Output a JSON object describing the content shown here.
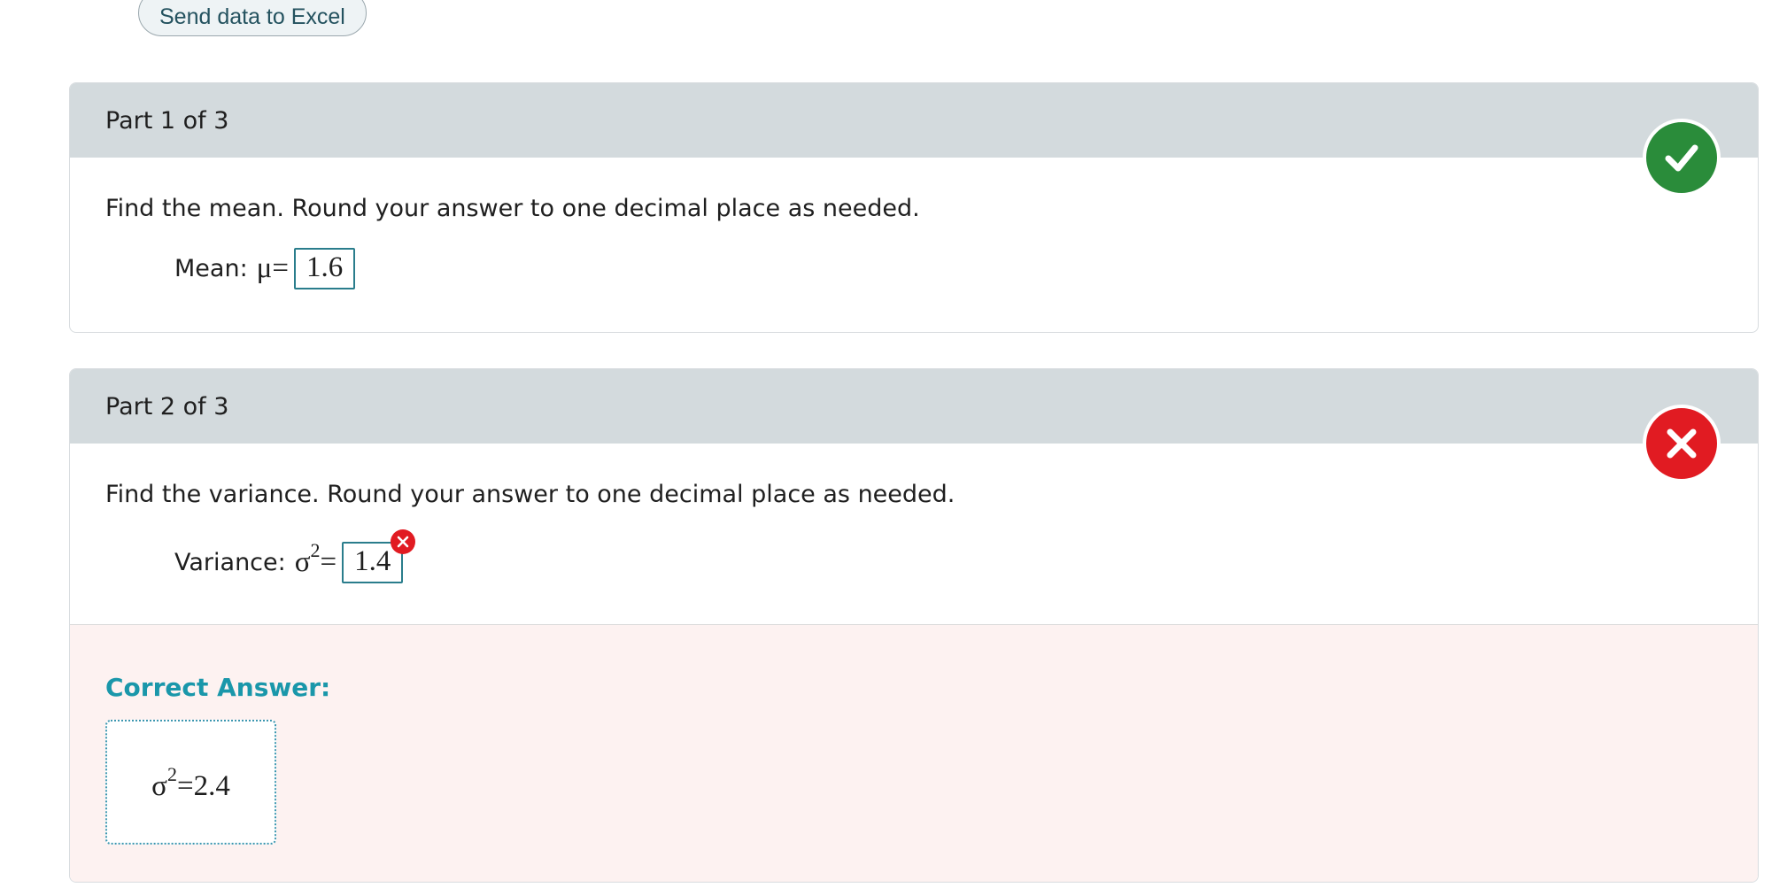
{
  "toolbar": {
    "send_excel_label": "Send data to Excel"
  },
  "parts": [
    {
      "title": "Part 1 of 3",
      "status": "correct",
      "status_icon": "check-icon",
      "status_color": "#2a8c3a",
      "instruction": "Find the mean. Round your answer to one decimal place as needed.",
      "answer_label": "Mean:",
      "symbol": "μ",
      "symbol_sup": "",
      "equals": "=",
      "answer_value": "1.6"
    },
    {
      "title": "Part 2 of 3",
      "status": "incorrect",
      "status_icon": "x-icon",
      "status_color": "#e11b22",
      "instruction": "Find the variance. Round your answer to one decimal place as needed.",
      "answer_label": "Variance:",
      "symbol": "σ",
      "symbol_sup": "2",
      "equals": "=",
      "answer_value": "1.4",
      "correct_answer": {
        "label": "Correct Answer:",
        "symbol": "σ",
        "symbol_sup": "2",
        "equals": "=",
        "value": "2.4"
      }
    }
  ],
  "colors": {
    "header_bg": "#d3dadd",
    "correct_label": "#1a97aa",
    "feedback_bg": "#fdf2f1"
  }
}
